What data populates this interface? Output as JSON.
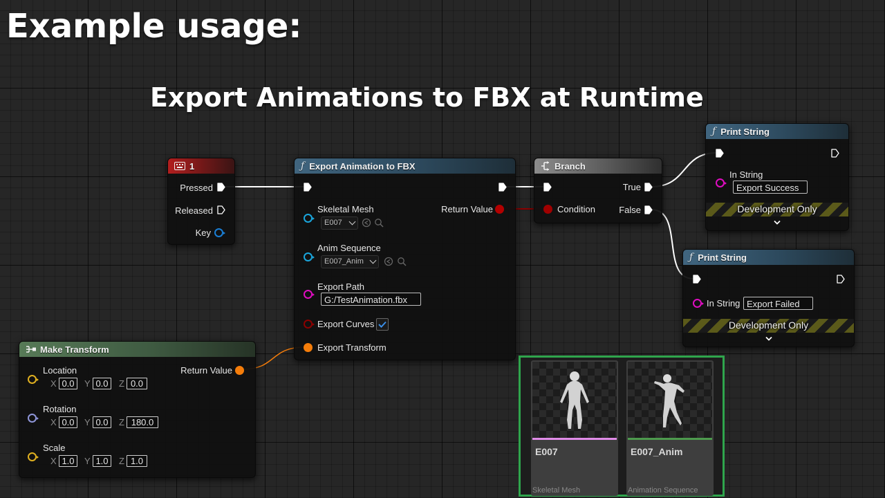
{
  "page": {
    "title": "Example usage:",
    "subtitle": "Export Animations to FBX at Runtime"
  },
  "colors": {
    "exec": "#ffffff",
    "object_pin": "#1aa6dd",
    "bool_pin": "#8c0000",
    "string_pin": "#e00dc1",
    "transform_pin": "#f57d0a",
    "vector_pin": "#e0b020",
    "rotator_pin": "#8f96d9",
    "selection_border": "#2fa54c"
  },
  "nodes": {
    "key_event": {
      "title": "1",
      "icon": "keyboard-icon",
      "pins": {
        "pressed": "Pressed",
        "released": "Released",
        "key": "Key"
      }
    },
    "export_fbx": {
      "title": "Export Animation to FBX",
      "icon": "function-icon",
      "pins": {
        "skeletal_mesh": "Skeletal Mesh",
        "skeletal_mesh_value": "E007",
        "anim_sequence": "Anim Sequence",
        "anim_sequence_value": "E007_Anim",
        "export_path": "Export Path",
        "export_path_value": "G:/TestAnimation.fbx",
        "export_curves": "Export Curves",
        "export_curves_checked": true,
        "export_transform": "Export Transform",
        "return_value": "Return Value"
      }
    },
    "branch": {
      "title": "Branch",
      "icon": "branch-icon",
      "pins": {
        "condition": "Condition",
        "true": "True",
        "false": "False"
      }
    },
    "print_success": {
      "title": "Print String",
      "in_string": "In String",
      "value": "Export Success",
      "dev_only": "Development Only"
    },
    "print_failed": {
      "title": "Print String",
      "in_string": "In String",
      "value": "Export Failed",
      "dev_only": "Development Only"
    },
    "make_transform": {
      "title": "Make Transform",
      "icon": "make-struct-icon",
      "return_value": "Return Value",
      "axes": {
        "x": "X",
        "y": "Y",
        "z": "Z"
      },
      "location": {
        "label": "Location",
        "x": "0.0",
        "y": "0.0",
        "z": "0.0"
      },
      "rotation": {
        "label": "Rotation",
        "x": "0.0",
        "y": "0.0",
        "z": "180.0"
      },
      "scale": {
        "label": "Scale",
        "x": "1.0",
        "y": "1.0",
        "z": "1.0"
      }
    }
  },
  "assets": [
    {
      "name": "E007",
      "type": "Skeletal Mesh",
      "accent": "#e08ce8"
    },
    {
      "name": "E007_Anim",
      "type": "Animation Sequence",
      "accent": "#4d9a4d"
    }
  ]
}
